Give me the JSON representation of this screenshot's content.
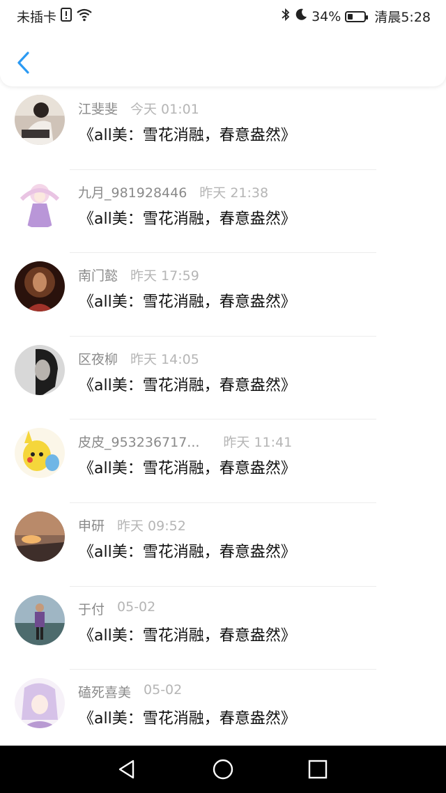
{
  "status_bar": {
    "carrier": "未插卡",
    "battery_percent": "34%",
    "battery_level": 0.34,
    "time": "清晨5:28"
  },
  "messages": [
    {
      "name": "江斐斐",
      "time": "今天 01:01",
      "text": "《all美：雪花消融，春意盎然》"
    },
    {
      "name": "九月_981928446",
      "time": "昨天 21:38",
      "text": "《all美：雪花消融，春意盎然》"
    },
    {
      "name": "南门懿",
      "time": "昨天 17:59",
      "text": "《all美：雪花消融，春意盎然》"
    },
    {
      "name": "区夜柳",
      "time": "昨天 14:05",
      "text": "《all美：雪花消融，春意盎然》"
    },
    {
      "name": "皮皮_953236717...",
      "time": "昨天 11:41",
      "text": "《all美：雪花消融，春意盎然》"
    },
    {
      "name": "申研",
      "time": "昨天 09:52",
      "text": "《all美：雪花消融，春意盎然》"
    },
    {
      "name": "于付",
      "time": "05-02",
      "text": "《all美：雪花消融，春意盎然》"
    },
    {
      "name": "磕死喜美",
      "time": "05-02",
      "text": "《all美：雪花消融，春意盎然》"
    }
  ],
  "colors": {
    "accent": "#2b9af3",
    "name_text": "#8a8a8a",
    "time_text": "#b5b5b5",
    "message_text": "#111111",
    "nav_bar": "#000000"
  },
  "icons": {
    "back": "chevron-left-icon",
    "nav_back": "triangle-back-icon",
    "nav_home": "circle-home-icon",
    "nav_recent": "square-recent-icon"
  }
}
